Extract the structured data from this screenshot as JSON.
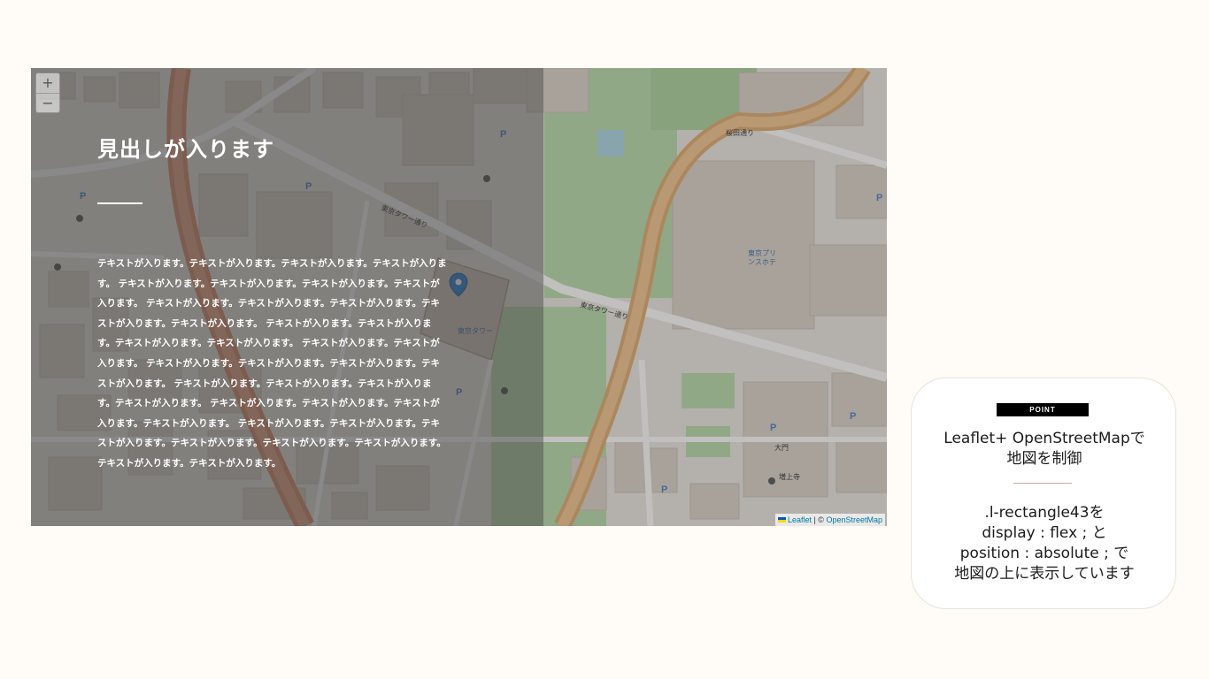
{
  "map": {
    "zoom_in_label": "+",
    "zoom_out_label": "−",
    "headline": "見出しが入ります",
    "body_text": "テキストが入ります。テキストが入ります。テキストが入ります。テキストが入ります。 テキストが入ります。テキストが入ります。テキストが入ります。テキストが入ります。 テキストが入ります。テキストが入ります。テキストが入ります。テキストが入ります。テキストが入ります。 テキストが入ります。テキストが入ります。テキストが入ります。テキストが入ります。 テキストが入ります。テキストが入ります。 テキストが入ります。テキストが入ります。テキストが入ります。テキストが入ります。 テキストが入ります。テキストが入ります。テキストが入ります。テキストが入ります。 テキストが入ります。テキストが入ります。テキストが入ります。テキストが入ります。 テキストが入ります。テキストが入ります。テキストが入ります。テキストが入ります。テキストが入ります。テキストが入ります。テキストが入ります。テキストが入ります。",
    "attribution_leaflet": "Leaflet",
    "attribution_sep": " | © ",
    "attribution_osm": "OpenStreetMap",
    "labels": {
      "tokyo_tower_street": "東京タワー通り",
      "sakurada_street": "桜田通り",
      "tokyo_tower": "東京タワー",
      "prince": "東京プリンスホテル",
      "daimon": "大門",
      "zojoji": "増上寺",
      "hibiya_street": "日比谷通り"
    },
    "colors": {
      "major_road": "#d98c6a",
      "secondary_road": "#e9b87a",
      "park": "#a9cf9a",
      "building": "#d4cbc2",
      "marker": "#2a7fd4"
    }
  },
  "card": {
    "badge": "POINT",
    "title_line1": "Leaflet+ OpenStreetMapで",
    "title_line2": "地図を制御",
    "desc_line1": ".l-rectangle43を",
    "desc_line2": "display : flex ; と",
    "desc_line3": "position : absolute ; で",
    "desc_line4": "地図の上に表示しています"
  }
}
